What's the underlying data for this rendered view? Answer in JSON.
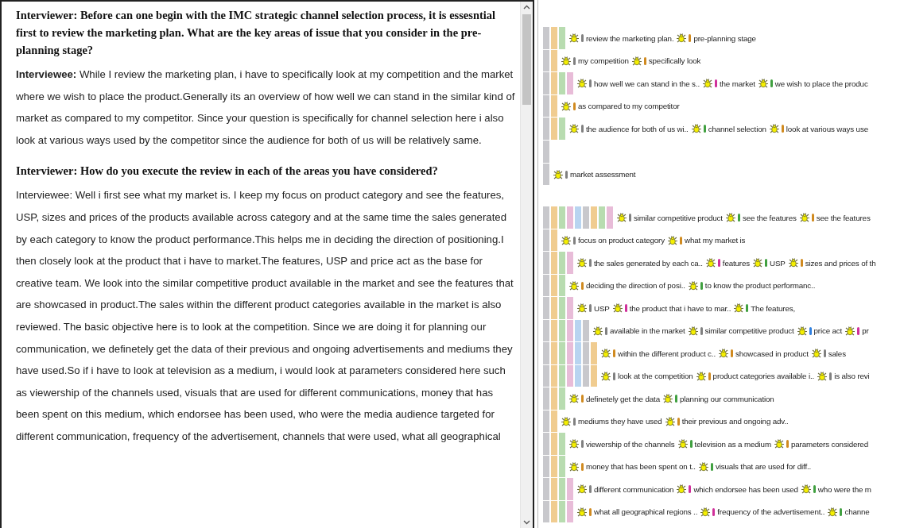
{
  "transcript": [
    {
      "kind": "question",
      "text": "Interviewer: Before can one begin with the IMC strategic channel selection process, it is essesntial first to review the marketing plan. What are the key areas of issue that you consider in the pre-planning stage?"
    },
    {
      "kind": "answer",
      "text": "**Interviewee:** While I review the marketing plan, i have to specifically look at my competition and the market where we wish to place the product.Generally its an overview of how well we can stand in the similar kind of market as compared to my competitor. Since your question is specifically for channel selection here i also look at various ways used by the competitor since the audience for both of us will be relatively same."
    },
    {
      "kind": "question",
      "text": "Interviewer: How do you execute the review in each of the areas you have considered?"
    },
    {
      "kind": "answer",
      "text": "Interviewee: Well i first see what my market is. I keep my focus on product category and see the features, USP, sizes and prices of the products available across category and at the same time the sales generated by each category to know the product performance.This helps me in deciding the direction of positioning.I then closely look at the product that i have to market.The features, USP and price act as the base for creative team. We look into the similar competitive product available in the market and see the features that are showcased in product.The sales within the different product categories available in the market is also reviewed. The basic objective here is to look at the competition. Since we are doing it for planning our communication, we definetely get the data of their previous and ongoing advertisements and mediums they have used.So if i have to look at television as a medium, i would look at parameters considered here such as viewership of the channels used, visuals that are used for different communications, money that has been spent on this medium, which endorsee has been used, who were the media audience targeted for different communication, frequency of the advertisement, channels that were used, what all geographical"
    }
  ],
  "coding_groups": [
    [
      {
        "kind": "codes",
        "bars": [
          {
            "color": "#c8c8cc"
          },
          {
            "color": "#f0cc90"
          },
          {
            "color": "#b8dcb0"
          }
        ],
        "codes": [
          {
            "text": "review the marketing plan.",
            "color": "#808080"
          },
          {
            "text": "pre-planning stage",
            "color": "#d08a20"
          }
        ]
      },
      {
        "kind": "codes",
        "bars": [
          {
            "color": "#c8c8cc"
          },
          {
            "color": "#f0cc90"
          }
        ],
        "codes": [
          {
            "text": "my competition",
            "color": "#808080"
          },
          {
            "text": "specifically look",
            "color": "#d08a20"
          }
        ]
      },
      {
        "kind": "codes",
        "bars": [
          {
            "color": "#c8c8cc"
          },
          {
            "color": "#f0cc90"
          },
          {
            "color": "#b8dcb0"
          },
          {
            "color": "#e8bcd8"
          }
        ],
        "codes": [
          {
            "text": "how well we can stand in the s..",
            "color": "#808080"
          },
          {
            "text": "the market",
            "color": "#d0309a"
          },
          {
            "text": "we wish to place the produc",
            "color": "#40a040"
          }
        ]
      },
      {
        "kind": "codes",
        "bars": [
          {
            "color": "#c8c8cc"
          },
          {
            "color": "#f0cc90"
          }
        ],
        "codes": [
          {
            "text": "as compared to my competitor",
            "color": "#d08a20"
          }
        ]
      },
      {
        "kind": "codes",
        "bars": [
          {
            "color": "#c8c8cc"
          },
          {
            "color": "#f0cc90"
          },
          {
            "color": "#b8dcb0"
          }
        ],
        "codes": [
          {
            "text": "the audience for both of us wi..",
            "color": "#808080"
          },
          {
            "text": "channel selection",
            "color": "#40a040"
          },
          {
            "text": "look at various ways use",
            "color": "#d08a20"
          }
        ]
      },
      {
        "kind": "bars",
        "bars": [
          {
            "color": "#c8c8cc"
          }
        ]
      },
      {
        "kind": "codes",
        "bars": [
          {
            "color": "#c8c8cc"
          }
        ],
        "codes": [
          {
            "text": "market assessment",
            "color": "#808080"
          }
        ]
      }
    ],
    [
      {
        "kind": "codes",
        "bars": [
          {
            "color": "#c8c8cc"
          },
          {
            "color": "#f0cc90"
          },
          {
            "color": "#b8dcb0"
          },
          {
            "color": "#e8bcd8"
          },
          {
            "color": "#b8d4f0"
          },
          {
            "color": "#c8c8cc"
          },
          {
            "color": "#f0cc90"
          },
          {
            "color": "#b8dcb0"
          },
          {
            "color": "#e8bcd8"
          }
        ],
        "codes": [
          {
            "text": "similar competitive product",
            "color": "#808080"
          },
          {
            "text": "see the features",
            "color": "#40a040"
          },
          {
            "text": "see the features",
            "color": "#d08a20"
          }
        ]
      },
      {
        "kind": "codes",
        "bars": [
          {
            "color": "#c8c8cc"
          },
          {
            "color": "#f0cc90"
          }
        ],
        "codes": [
          {
            "text": "focus on product category",
            "color": "#808080"
          },
          {
            "text": "what my market is",
            "color": "#d08a20"
          }
        ]
      },
      {
        "kind": "codes",
        "bars": [
          {
            "color": "#c8c8cc"
          },
          {
            "color": "#f0cc90"
          },
          {
            "color": "#b8dcb0"
          },
          {
            "color": "#e8bcd8"
          }
        ],
        "codes": [
          {
            "text": "the sales generated by each ca..",
            "color": "#808080"
          },
          {
            "text": "features",
            "color": "#d0309a"
          },
          {
            "text": "USP",
            "color": "#40a040"
          },
          {
            "text": "sizes and prices of th",
            "color": "#d08a20"
          }
        ]
      },
      {
        "kind": "codes",
        "bars": [
          {
            "color": "#c8c8cc"
          },
          {
            "color": "#f0cc90"
          },
          {
            "color": "#b8dcb0"
          }
        ],
        "codes": [
          {
            "text": "deciding the direction of posi..",
            "color": "#d08a20"
          },
          {
            "text": "to know the product performanc..",
            "color": "#40a040"
          }
        ]
      },
      {
        "kind": "codes",
        "bars": [
          {
            "color": "#c8c8cc"
          },
          {
            "color": "#f0cc90"
          },
          {
            "color": "#b8dcb0"
          },
          {
            "color": "#e8bcd8"
          }
        ],
        "codes": [
          {
            "text": "USP",
            "color": "#808080"
          },
          {
            "text": "the product that i have to mar..",
            "color": "#d0309a"
          },
          {
            "text": "The features,",
            "color": "#40a040"
          }
        ]
      },
      {
        "kind": "codes",
        "bars": [
          {
            "color": "#c8c8cc"
          },
          {
            "color": "#f0cc90"
          },
          {
            "color": "#b8dcb0"
          },
          {
            "color": "#e8bcd8"
          },
          {
            "color": "#b8d4f0"
          },
          {
            "color": "#c8c8cc"
          }
        ],
        "codes": [
          {
            "text": "available in the market",
            "color": "#808080"
          },
          {
            "text": "similar competitive product",
            "color": "#808080"
          },
          {
            "text": "price act",
            "color": "#3080e0"
          },
          {
            "text": "pr",
            "color": "#d0309a"
          }
        ]
      },
      {
        "kind": "codes",
        "bars": [
          {
            "color": "#c8c8cc"
          },
          {
            "color": "#f0cc90"
          },
          {
            "color": "#b8dcb0"
          },
          {
            "color": "#e8bcd8"
          },
          {
            "color": "#b8d4f0"
          },
          {
            "color": "#c8c8cc"
          },
          {
            "color": "#f0cc90"
          }
        ],
        "codes": [
          {
            "text": "within the different product c..",
            "color": "#d08a20"
          },
          {
            "text": "showcased in product",
            "color": "#d08a20"
          },
          {
            "text": "sales",
            "color": "#808080"
          }
        ]
      },
      {
        "kind": "codes",
        "bars": [
          {
            "color": "#c8c8cc"
          },
          {
            "color": "#f0cc90"
          },
          {
            "color": "#b8dcb0"
          },
          {
            "color": "#e8bcd8"
          },
          {
            "color": "#b8d4f0"
          },
          {
            "color": "#c8c8cc"
          },
          {
            "color": "#f0cc90"
          }
        ],
        "codes": [
          {
            "text": "look at the competition",
            "color": "#808080"
          },
          {
            "text": "product categories available i..",
            "color": "#d08a20"
          },
          {
            "text": "is also revi",
            "color": "#808080"
          }
        ]
      },
      {
        "kind": "codes",
        "bars": [
          {
            "color": "#c8c8cc"
          },
          {
            "color": "#f0cc90"
          },
          {
            "color": "#b8dcb0"
          }
        ],
        "codes": [
          {
            "text": "definetely get the data",
            "color": "#d08a20"
          },
          {
            "text": "planning our communication",
            "color": "#40a040"
          }
        ]
      },
      {
        "kind": "codes",
        "bars": [
          {
            "color": "#c8c8cc"
          },
          {
            "color": "#f0cc90"
          }
        ],
        "codes": [
          {
            "text": "mediums they have used",
            "color": "#808080"
          },
          {
            "text": "their previous and ongoing adv..",
            "color": "#d08a20"
          }
        ]
      },
      {
        "kind": "codes",
        "bars": [
          {
            "color": "#c8c8cc"
          },
          {
            "color": "#f0cc90"
          },
          {
            "color": "#b8dcb0"
          }
        ],
        "codes": [
          {
            "text": "viewership of the channels",
            "color": "#808080"
          },
          {
            "text": "television as a medium",
            "color": "#40a040"
          },
          {
            "text": "parameters considered",
            "color": "#d08a20"
          }
        ]
      },
      {
        "kind": "codes",
        "bars": [
          {
            "color": "#c8c8cc"
          },
          {
            "color": "#f0cc90"
          },
          {
            "color": "#b8dcb0"
          }
        ],
        "codes": [
          {
            "text": "money that has been spent on t..",
            "color": "#d08a20"
          },
          {
            "text": "visuals that are used for diff..",
            "color": "#40a040"
          }
        ]
      },
      {
        "kind": "codes",
        "bars": [
          {
            "color": "#c8c8cc"
          },
          {
            "color": "#f0cc90"
          },
          {
            "color": "#b8dcb0"
          },
          {
            "color": "#e8bcd8"
          }
        ],
        "codes": [
          {
            "text": "different communication",
            "color": "#808080"
          },
          {
            "text": "which endorsee has been used",
            "color": "#d0309a"
          },
          {
            "text": "who were the m",
            "color": "#40a040"
          }
        ]
      },
      {
        "kind": "codes",
        "bars": [
          {
            "color": "#c8c8cc"
          },
          {
            "color": "#f0cc90"
          },
          {
            "color": "#b8dcb0"
          },
          {
            "color": "#e8bcd8"
          }
        ],
        "codes": [
          {
            "text": "what all geographical regions ..",
            "color": "#d08a20"
          },
          {
            "text": "frequency of the advertisement..",
            "color": "#d0309a"
          },
          {
            "text": "channe",
            "color": "#40a040"
          }
        ]
      }
    ]
  ]
}
